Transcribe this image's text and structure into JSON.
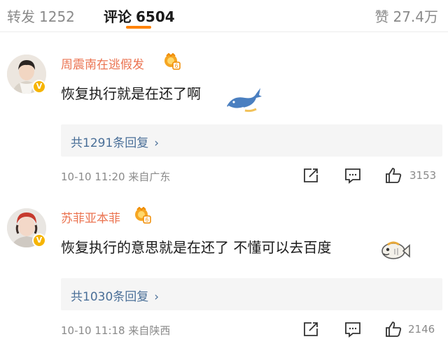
{
  "tabs": {
    "repost": {
      "label": "转发",
      "count": "1252"
    },
    "comment": {
      "label": "评论",
      "count": "6504"
    },
    "like": {
      "label": "赞",
      "count": "27.4万"
    }
  },
  "colors": {
    "accent": "#ff8200",
    "username": "#eb7350",
    "link": "#4a6f98",
    "muted": "#8a8a8a"
  },
  "comments": [
    {
      "username": "周震南在逃假发",
      "content": "恢复执行就是在还了啊",
      "sticker": "whale-sticker",
      "replies_label": "共1291条回复",
      "time_location": "10-10 11:20 来自广东",
      "likes": "3153"
    },
    {
      "username": "苏菲亚本菲",
      "content": "恢复执行的意思就是在还了 不懂可以去百度",
      "sticker": "fish-sticker",
      "replies_label": "共1030条回复",
      "time_location": "10-10 11:18 来自陕西",
      "likes": "2146"
    }
  ],
  "icons": {
    "chevron": "›",
    "verified": "V"
  }
}
